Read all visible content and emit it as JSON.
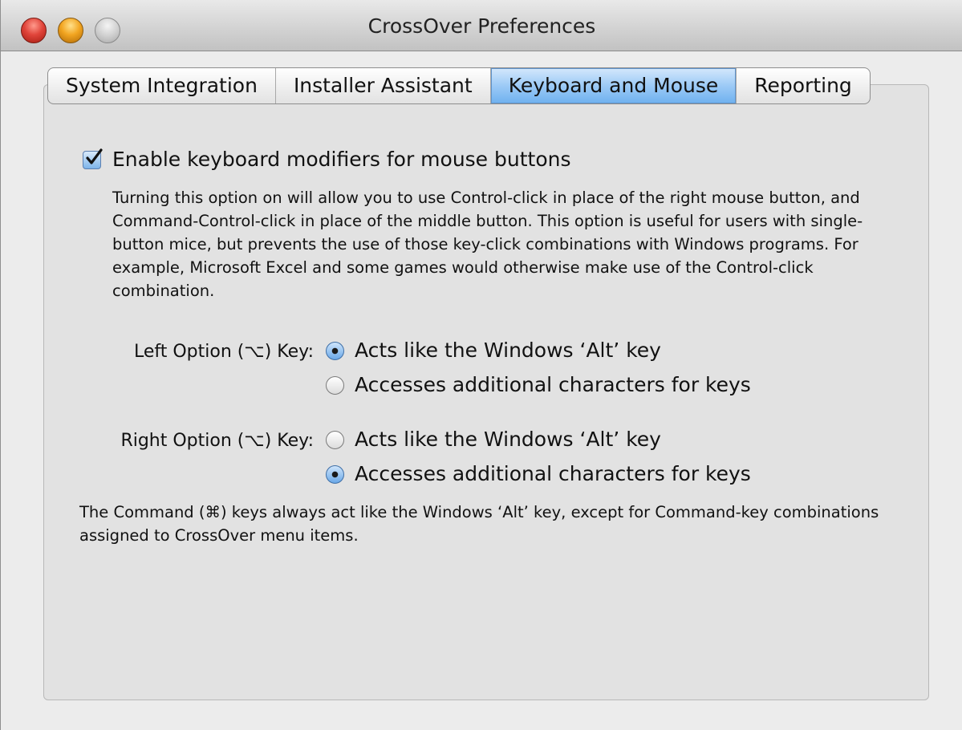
{
  "window": {
    "title": "CrossOver Preferences"
  },
  "tabs": [
    {
      "label": "System Integration",
      "active": false
    },
    {
      "label": "Installer Assistant",
      "active": false
    },
    {
      "label": "Keyboard and Mouse",
      "active": true
    },
    {
      "label": "Reporting",
      "active": false
    }
  ],
  "modifiers": {
    "checkbox_label": "Enable keyboard modifiers for mouse buttons",
    "checked": true,
    "description": "Turning this option on will allow you to use Control-click in place of the right mouse button, and Command-Control-click in place of the middle button. This option is useful for users with single-button mice, but prevents the use of those key-click combinations with Windows programs. For example, Microsoft Excel and some games would otherwise make use of the Control-click combination."
  },
  "left_option": {
    "label": "Left Option (⌥) Key:",
    "options": [
      {
        "label": "Acts like the Windows ‘Alt’ key",
        "selected": true
      },
      {
        "label": "Accesses additional characters for keys",
        "selected": false
      }
    ]
  },
  "right_option": {
    "label": "Right Option (⌥) Key:",
    "options": [
      {
        "label": "Acts like the Windows ‘Alt’ key",
        "selected": false
      },
      {
        "label": "Accesses additional characters for keys",
        "selected": true
      }
    ]
  },
  "footnote": "The Command (⌘) keys always act like the Windows ‘Alt’ key, except for Command-key combinations assigned to CrossOver menu items.",
  "colors": {
    "accent": "#6fb1ef",
    "window_bg": "#ececec"
  }
}
